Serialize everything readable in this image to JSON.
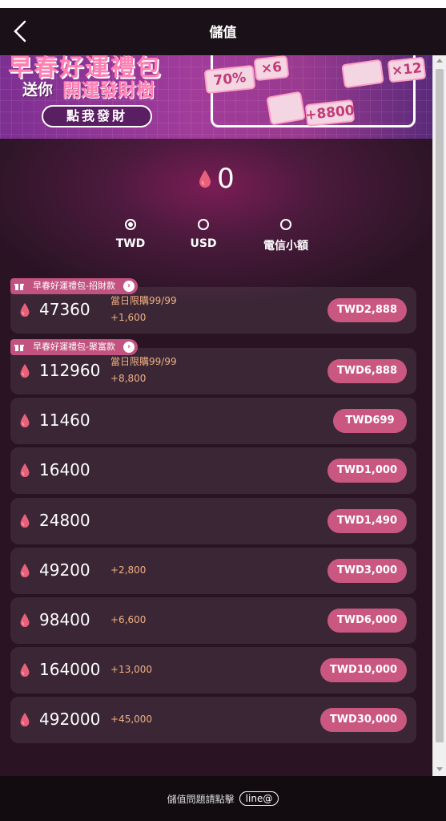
{
  "header": {
    "title": "儲值"
  },
  "banner": {
    "title": "早春好運禮包",
    "sub_prefix": "送你",
    "sub_highlight": "開運發財樹",
    "button_label": "點我發財",
    "tickets": [
      "70%",
      "×6",
      "",
      "+8800",
      "",
      "×12"
    ]
  },
  "balance": {
    "value": "0"
  },
  "currencies": [
    {
      "label": "TWD",
      "selected": true
    },
    {
      "label": "USD",
      "selected": false
    },
    {
      "label": "電信小額",
      "selected": false
    }
  ],
  "packages": [
    {
      "tag": "早春好運禮包-招財款",
      "amount": "47360",
      "limit": "當日限購99/99",
      "bonus": "+1,600",
      "price": "TWD2,888"
    },
    {
      "tag": "早春好運禮包-聚富款",
      "amount": "112960",
      "limit": "當日限購99/99",
      "bonus": "+8,800",
      "price": "TWD6,888"
    },
    {
      "tag": "",
      "amount": "11460",
      "limit": "",
      "bonus": "",
      "price": "TWD699"
    },
    {
      "tag": "",
      "amount": "16400",
      "limit": "",
      "bonus": "",
      "price": "TWD1,000"
    },
    {
      "tag": "",
      "amount": "24800",
      "limit": "",
      "bonus": "",
      "price": "TWD1,490"
    },
    {
      "tag": "",
      "amount": "49200",
      "limit": "",
      "bonus": "+2,800",
      "price": "TWD3,000"
    },
    {
      "tag": "",
      "amount": "98400",
      "limit": "",
      "bonus": "+6,600",
      "price": "TWD6,000"
    },
    {
      "tag": "",
      "amount": "164000",
      "limit": "",
      "bonus": "+13,000",
      "price": "TWD10,000"
    },
    {
      "tag": "",
      "amount": "492000",
      "limit": "",
      "bonus": "+45,000",
      "price": "TWD30,000"
    }
  ],
  "footer": {
    "text": "儲值問題請點擊",
    "link_label": "line@"
  },
  "colors": {
    "accent": "#c9577f",
    "bonus": "#f0b080",
    "drop": "#e8607a"
  },
  "icons": {
    "back": "chevron-left-icon",
    "drop": "gem-drop-icon",
    "gift": "gift-icon"
  }
}
